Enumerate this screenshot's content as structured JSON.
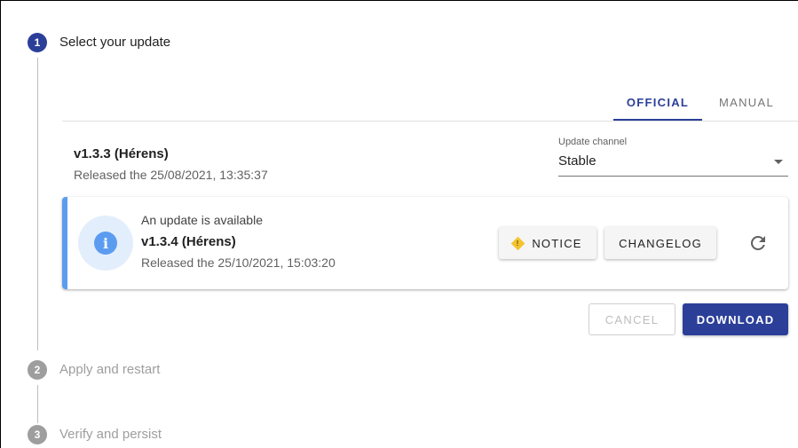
{
  "steps": [
    {
      "number": "1",
      "title": "Select your update"
    },
    {
      "number": "2",
      "title": "Apply and restart"
    },
    {
      "number": "3",
      "title": "Verify and persist"
    }
  ],
  "tabs": {
    "official": "OFFICIAL",
    "manual": "MANUAL"
  },
  "current": {
    "version": "v1.3.3 (Hérens)",
    "released": "Released the 25/08/2021, 13:35:37"
  },
  "channel": {
    "label": "Update channel",
    "value": "Stable"
  },
  "update_alert": {
    "title": "An update is available",
    "version": "v1.3.4 (Hérens)",
    "released": "Released the 25/10/2021, 15:03:20",
    "notice_label": "NOTICE",
    "changelog_label": "CHANGELOG",
    "icon": "info-icon"
  },
  "actions": {
    "cancel_label": "CANCEL",
    "download_label": "DOWNLOAD"
  },
  "colors": {
    "primary": "#2b3f99",
    "info": "#5b9cf0",
    "warning": "#f4c430",
    "inactive": "#9e9e9e"
  }
}
